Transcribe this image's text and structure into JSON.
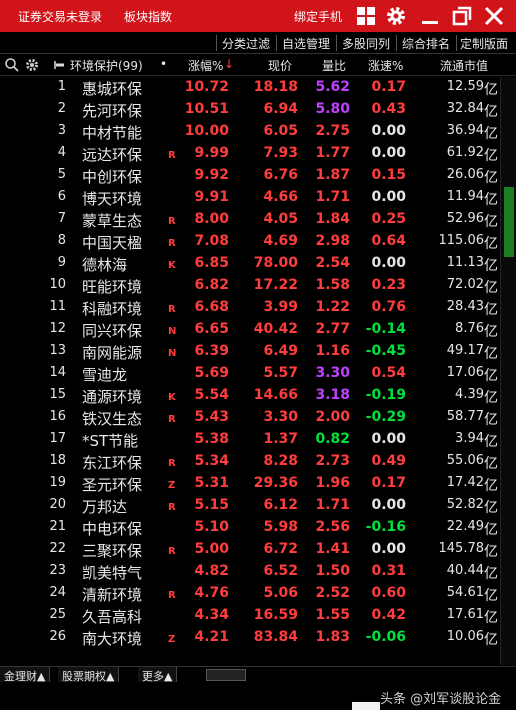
{
  "titlebar": {
    "trade_status": "证券交易未登录",
    "sector_index": "板块指数",
    "bind_phone": "绑定手机"
  },
  "menu": [
    "分类过滤",
    "自选管理",
    "多股同列",
    "综合排名",
    "定制版面"
  ],
  "header": {
    "group_name": "环境保护(99)",
    "dot": "•",
    "change": "涨幅%",
    "sort_arrow": "↓",
    "price": "现价",
    "volume_ratio": "量比",
    "speed": "涨速%",
    "market_cap": "流通市值"
  },
  "colors": {
    "title_red": "#d1131a",
    "up_red": "#ff3d3d",
    "down_green": "#00e13a",
    "flat_white": "#e6e6e6",
    "purple": "#c040ff"
  },
  "rows": [
    {
      "idx": "1",
      "name": "惠城环保",
      "flag": "",
      "chg": "10.72",
      "price": "18.18",
      "vol": "5.62",
      "vc": "purple",
      "spd": "0.17",
      "sc": "up",
      "cap": "12.59"
    },
    {
      "idx": "2",
      "name": "先河环保",
      "flag": "",
      "chg": "10.51",
      "price": "6.94",
      "vol": "5.80",
      "vc": "purple",
      "spd": "0.43",
      "sc": "up",
      "cap": "32.84"
    },
    {
      "idx": "3",
      "name": "中材节能",
      "flag": "",
      "chg": "10.00",
      "price": "6.05",
      "vol": "2.75",
      "vc": "up",
      "spd": "0.00",
      "sc": "flat",
      "cap": "36.94"
    },
    {
      "idx": "4",
      "name": "远达环保",
      "flag": "R",
      "chg": "9.99",
      "price": "7.93",
      "vol": "1.77",
      "vc": "up",
      "spd": "0.00",
      "sc": "flat",
      "cap": "61.92"
    },
    {
      "idx": "5",
      "name": "中创环保",
      "flag": "",
      "chg": "9.92",
      "price": "6.76",
      "vol": "1.87",
      "vc": "up",
      "spd": "0.15",
      "sc": "up",
      "cap": "26.06"
    },
    {
      "idx": "6",
      "name": "博天环境",
      "flag": "",
      "chg": "9.91",
      "price": "4.66",
      "vol": "1.71",
      "vc": "up",
      "spd": "0.00",
      "sc": "flat",
      "cap": "11.94"
    },
    {
      "idx": "7",
      "name": "蒙草生态",
      "flag": "R",
      "chg": "8.00",
      "price": "4.05",
      "vol": "1.84",
      "vc": "up",
      "spd": "0.25",
      "sc": "up",
      "cap": "52.96"
    },
    {
      "idx": "8",
      "name": "中国天楹",
      "flag": "R",
      "chg": "7.08",
      "price": "4.69",
      "vol": "2.98",
      "vc": "up",
      "spd": "0.64",
      "sc": "up",
      "cap": "115.06"
    },
    {
      "idx": "9",
      "name": "德林海",
      "flag": "K",
      "chg": "6.85",
      "price": "78.00",
      "vol": "2.54",
      "vc": "up",
      "spd": "0.00",
      "sc": "flat",
      "cap": "11.13"
    },
    {
      "idx": "10",
      "name": "旺能环境",
      "flag": "",
      "chg": "6.82",
      "price": "17.22",
      "vol": "1.58",
      "vc": "up",
      "spd": "0.23",
      "sc": "up",
      "cap": "72.02"
    },
    {
      "idx": "11",
      "name": "科融环境",
      "flag": "R",
      "chg": "6.68",
      "price": "3.99",
      "vol": "1.22",
      "vc": "up",
      "spd": "0.76",
      "sc": "up",
      "cap": "28.43"
    },
    {
      "idx": "12",
      "name": "同兴环保",
      "flag": "N",
      "chg": "6.65",
      "price": "40.42",
      "vol": "2.77",
      "vc": "up",
      "spd": "-0.14",
      "sc": "down",
      "cap": "8.76"
    },
    {
      "idx": "13",
      "name": "南网能源",
      "flag": "N",
      "chg": "6.39",
      "price": "6.49",
      "vol": "1.16",
      "vc": "up",
      "spd": "-0.45",
      "sc": "down",
      "cap": "49.17"
    },
    {
      "idx": "14",
      "name": "雪迪龙",
      "flag": "",
      "chg": "5.69",
      "price": "5.57",
      "vol": "3.30",
      "vc": "purple",
      "spd": "0.54",
      "sc": "up",
      "cap": "17.06"
    },
    {
      "idx": "15",
      "name": "通源环境",
      "flag": "K",
      "chg": "5.54",
      "price": "14.66",
      "vol": "3.18",
      "vc": "purple",
      "spd": "-0.19",
      "sc": "down",
      "cap": "4.39"
    },
    {
      "idx": "16",
      "name": "铁汉生态",
      "flag": "R",
      "chg": "5.43",
      "price": "3.30",
      "vol": "2.00",
      "vc": "up",
      "spd": "-0.29",
      "sc": "down",
      "cap": "58.77"
    },
    {
      "idx": "17",
      "name": "*ST节能",
      "flag": "",
      "chg": "5.38",
      "price": "1.37",
      "vol": "0.82",
      "vc": "down",
      "spd": "0.00",
      "sc": "flat",
      "cap": "3.94"
    },
    {
      "idx": "18",
      "name": "东江环保",
      "flag": "R",
      "chg": "5.34",
      "price": "8.28",
      "vol": "2.73",
      "vc": "up",
      "spd": "0.49",
      "sc": "up",
      "cap": "55.06"
    },
    {
      "idx": "19",
      "name": "圣元环保",
      "flag": "Z",
      "chg": "5.31",
      "price": "29.36",
      "vol": "1.96",
      "vc": "up",
      "spd": "0.17",
      "sc": "up",
      "cap": "17.42"
    },
    {
      "idx": "20",
      "name": "万邦达",
      "flag": "R",
      "chg": "5.15",
      "price": "6.12",
      "vol": "1.71",
      "vc": "up",
      "spd": "0.00",
      "sc": "flat",
      "cap": "52.82"
    },
    {
      "idx": "21",
      "name": "中电环保",
      "flag": "",
      "chg": "5.10",
      "price": "5.98",
      "vol": "2.56",
      "vc": "up",
      "spd": "-0.16",
      "sc": "down",
      "cap": "22.49"
    },
    {
      "idx": "22",
      "name": "三聚环保",
      "flag": "R",
      "chg": "5.00",
      "price": "6.72",
      "vol": "1.41",
      "vc": "up",
      "spd": "0.00",
      "sc": "flat",
      "cap": "145.78"
    },
    {
      "idx": "23",
      "name": "凯美特气",
      "flag": "",
      "chg": "4.82",
      "price": "6.52",
      "vol": "1.50",
      "vc": "up",
      "spd": "0.31",
      "sc": "up",
      "cap": "40.44"
    },
    {
      "idx": "24",
      "name": "清新环境",
      "flag": "R",
      "chg": "4.76",
      "price": "5.06",
      "vol": "2.52",
      "vc": "up",
      "spd": "0.60",
      "sc": "up",
      "cap": "54.61"
    },
    {
      "idx": "25",
      "name": "久吾高科",
      "flag": "",
      "chg": "4.34",
      "price": "16.59",
      "vol": "1.55",
      "vc": "up",
      "spd": "0.42",
      "sc": "up",
      "cap": "17.61"
    },
    {
      "idx": "26",
      "name": "南大环境",
      "flag": "Z",
      "chg": "4.21",
      "price": "83.84",
      "vol": "1.83",
      "vc": "up",
      "spd": "-0.06",
      "sc": "down",
      "cap": "10.06"
    }
  ],
  "unit_yi": "亿",
  "tabs": [
    "金理财▲",
    "股票期权▲",
    "更多▲"
  ],
  "watermark": "头条 @刘军谈股论金"
}
